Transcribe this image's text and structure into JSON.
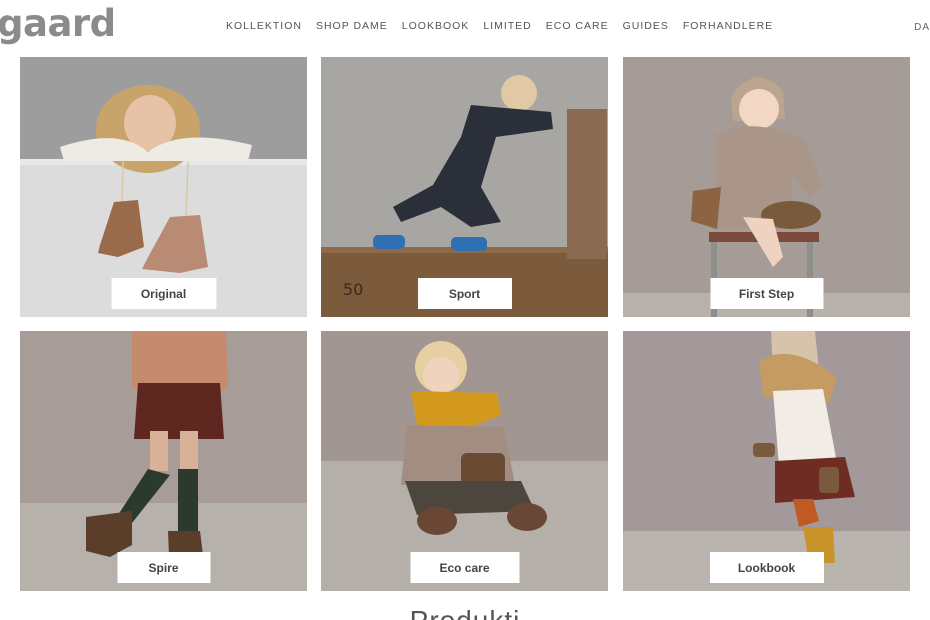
{
  "header": {
    "logo_text": "gaard",
    "nav": [
      {
        "label": "KOLLEKTION"
      },
      {
        "label": "SHOP DAME"
      },
      {
        "label": "LOOKBOOK"
      },
      {
        "label": "LIMITED"
      },
      {
        "label": "ECO CARE"
      },
      {
        "label": "GUIDES"
      },
      {
        "label": "FORHANDLERE"
      }
    ],
    "lang": "DA"
  },
  "tiles": [
    {
      "label": "Original"
    },
    {
      "label": "Sport"
    },
    {
      "label": "First Step"
    },
    {
      "label": "Spire"
    },
    {
      "label": "Eco care"
    },
    {
      "label": "Lookbook"
    }
  ],
  "section": {
    "title": "Produkti"
  },
  "colors": {
    "logo": "#8b8b8b",
    "wall_grey": "#a9a6a4",
    "wall_mauve": "#9c918d",
    "floor": "#b9b4ad",
    "wood": "#7a5a3e",
    "button_bg": "#ffffff"
  }
}
